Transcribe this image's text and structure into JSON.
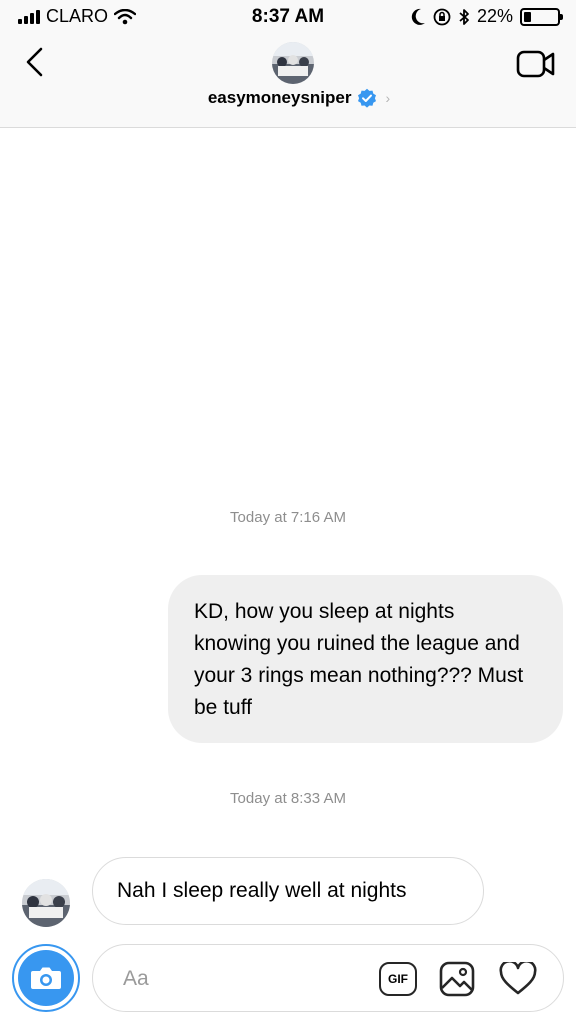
{
  "status_bar": {
    "carrier": "CLARO",
    "time": "8:37 AM",
    "battery_percent": "22%",
    "battery_level": 0.22
  },
  "header": {
    "username": "easymoneysniper",
    "verified": true,
    "chevron": "›"
  },
  "thread": {
    "messages": [
      {
        "timestamp": "Today at 7:16 AM"
      },
      {
        "direction": "outgoing",
        "text": "KD, how you sleep at nights knowing you ruined the league and your 3 rings mean nothing??? Must be tuff"
      },
      {
        "timestamp": "Today at 8:33 AM"
      },
      {
        "direction": "incoming",
        "text": "Nah I sleep really well at nights"
      }
    ]
  },
  "composer": {
    "placeholder": "Aa",
    "value": "",
    "gif_label": "GIF"
  },
  "colors": {
    "accent": "#3897f0",
    "bubble_outgoing": "#efefef",
    "border": "#dbdbdb",
    "timestamp": "#8e8e8e"
  },
  "icons": [
    "signal-icon",
    "wifi-icon",
    "moon-icon",
    "orientation-lock-icon",
    "bluetooth-icon",
    "battery-icon",
    "back-arrow-icon",
    "video-camera-icon",
    "verified-badge-icon",
    "camera-icon",
    "gif-icon",
    "gallery-icon",
    "heart-icon"
  ]
}
